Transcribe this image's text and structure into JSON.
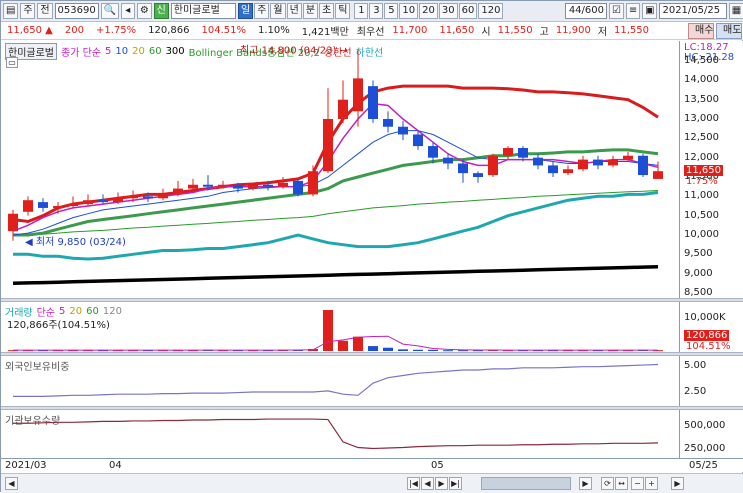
{
  "toolbar": {
    "mode_label": "주",
    "type_label": "전",
    "stock_code": "053690",
    "stock_name": "한미글로벌",
    "period_tabs": [
      "일",
      "주",
      "월",
      "년",
      "분",
      "초",
      "틱"
    ],
    "interval_buttons": [
      "1",
      "3",
      "5",
      "10",
      "20",
      "30",
      "60",
      "120"
    ],
    "count_display": "44/600",
    "date_display": "2021/05/25",
    "sin_label": "신"
  },
  "info": {
    "price": "11,650",
    "change": "200",
    "change_pct": "+1.75%",
    "volume": "120,866",
    "volume_ratio": "104.51%",
    "turnover": "1.10%",
    "amount": "1,421백만",
    "label_best": "최우선",
    "best_price": "11,700",
    "best_price2": "11,650",
    "open_label": "시",
    "open": "11,550",
    "high_label": "고",
    "high": "11,900",
    "low_label": "저",
    "low": "11,550",
    "buy_label": "매수",
    "sell_label": "매도"
  },
  "price_panel": {
    "legend_name": "한미글로벌",
    "legend_ma_label": "종가 단순",
    "legend_ma": [
      "5",
      "10",
      "20",
      "60",
      "300"
    ],
    "legend_bb": "Bollinger Bands중심선 20,2",
    "legend_upper": "상한선",
    "legend_lower": "하한선",
    "high_annotation": "최고 14,800 (04/23)",
    "low_annotation": "최저 9,850 (03/24)",
    "lc_label": "LC:18.27",
    "hc_label": "HC:-21.28",
    "current_price_badge": "11,650",
    "current_pct_badge": "1.75%",
    "ticks": [
      "14,500",
      "14,000",
      "13,500",
      "13,000",
      "12,500",
      "12,000",
      "11,500",
      "11,000",
      "10,500",
      "10,000",
      "9,500",
      "9,000",
      "8,500"
    ]
  },
  "volume_panel": {
    "legend_label": "거래량",
    "legend_ma_label": "단순",
    "legend_ma": [
      "5",
      "20",
      "60",
      "120"
    ],
    "sub_label": "120,866주(104.51%)",
    "tick_top": "10,000K",
    "badge_value": "120,866",
    "badge_pct": "104.51%"
  },
  "foreign_panel": {
    "legend_label": "외국인보유비중",
    "ticks": [
      "5.00",
      "2.50"
    ]
  },
  "inst_panel": {
    "legend_label": "기관보유수량",
    "ticks": [
      "500,000",
      "250,000"
    ]
  },
  "xaxis": {
    "labels": [
      "2021/03",
      "04",
      "05",
      "05/25"
    ]
  },
  "chart_data": {
    "type": "line",
    "ylim": [
      8500,
      14500
    ],
    "candles": [
      {
        "o": 10100,
        "c": 10550,
        "h": 10650,
        "l": 9850
      },
      {
        "o": 10600,
        "c": 10900,
        "h": 11000,
        "l": 10500
      },
      {
        "o": 10850,
        "c": 10700,
        "h": 10950,
        "l": 10600
      },
      {
        "o": 10700,
        "c": 10750,
        "h": 10850,
        "l": 10550
      },
      {
        "o": 10750,
        "c": 10800,
        "h": 11000,
        "l": 10700
      },
      {
        "o": 10800,
        "c": 10900,
        "h": 11050,
        "l": 10750
      },
      {
        "o": 10900,
        "c": 10850,
        "h": 11050,
        "l": 10800
      },
      {
        "o": 10850,
        "c": 10950,
        "h": 11100,
        "l": 10800
      },
      {
        "o": 10950,
        "c": 11000,
        "h": 11150,
        "l": 10850
      },
      {
        "o": 11000,
        "c": 10950,
        "h": 11100,
        "l": 10850
      },
      {
        "o": 10950,
        "c": 11050,
        "h": 11200,
        "l": 10900
      },
      {
        "o": 11050,
        "c": 11200,
        "h": 11400,
        "l": 11000
      },
      {
        "o": 11200,
        "c": 11300,
        "h": 11450,
        "l": 11100
      },
      {
        "o": 11300,
        "c": 11250,
        "h": 11550,
        "l": 11150
      },
      {
        "o": 11250,
        "c": 11300,
        "h": 11400,
        "l": 11200
      },
      {
        "o": 11300,
        "c": 11200,
        "h": 11350,
        "l": 11100
      },
      {
        "o": 11200,
        "c": 11300,
        "h": 11350,
        "l": 11150
      },
      {
        "o": 11300,
        "c": 11250,
        "h": 11400,
        "l": 11150
      },
      {
        "o": 11250,
        "c": 11350,
        "h": 11500,
        "l": 11200
      },
      {
        "o": 11400,
        "c": 11050,
        "h": 11450,
        "l": 11000
      },
      {
        "o": 11050,
        "c": 11650,
        "h": 11800,
        "l": 11000
      },
      {
        "o": 11650,
        "c": 13000,
        "h": 13800,
        "l": 11600
      },
      {
        "o": 13000,
        "c": 13500,
        "h": 14000,
        "l": 12900
      },
      {
        "o": 13200,
        "c": 14050,
        "h": 14800,
        "l": 12800
      },
      {
        "o": 13850,
        "c": 13000,
        "h": 14000,
        "l": 12900
      },
      {
        "o": 13000,
        "c": 12800,
        "h": 13200,
        "l": 12650
      },
      {
        "o": 12800,
        "c": 12600,
        "h": 12950,
        "l": 12450
      },
      {
        "o": 12600,
        "c": 12300,
        "h": 12700,
        "l": 12200
      },
      {
        "o": 12300,
        "c": 12000,
        "h": 12400,
        "l": 11850
      },
      {
        "o": 12000,
        "c": 11850,
        "h": 12100,
        "l": 11700
      },
      {
        "o": 11850,
        "c": 11600,
        "h": 11950,
        "l": 11350
      },
      {
        "o": 11600,
        "c": 11500,
        "h": 11650,
        "l": 11350
      },
      {
        "o": 11550,
        "c": 12050,
        "h": 12100,
        "l": 11500
      },
      {
        "o": 12050,
        "c": 12250,
        "h": 12300,
        "l": 11950
      },
      {
        "o": 12250,
        "c": 12000,
        "h": 12300,
        "l": 11900
      },
      {
        "o": 12000,
        "c": 11800,
        "h": 12100,
        "l": 11700
      },
      {
        "o": 11800,
        "c": 11600,
        "h": 11900,
        "l": 11500
      },
      {
        "o": 11600,
        "c": 11700,
        "h": 11800,
        "l": 11550
      },
      {
        "o": 11700,
        "c": 11950,
        "h": 12050,
        "l": 11650
      },
      {
        "o": 11950,
        "c": 11800,
        "h": 12050,
        "l": 11700
      },
      {
        "o": 11800,
        "c": 11950,
        "h": 12050,
        "l": 11750
      },
      {
        "o": 11950,
        "c": 12050,
        "h": 12150,
        "l": 11900
      },
      {
        "o": 12050,
        "c": 11550,
        "h": 12100,
        "l": 11500
      },
      {
        "o": 11450,
        "c": 11650,
        "h": 11900,
        "l": 11550
      }
    ],
    "bb_upper": [
      10400,
      10350,
      10500,
      10700,
      10800,
      10850,
      10900,
      10950,
      11000,
      11050,
      11050,
      11100,
      11150,
      11200,
      11250,
      11300,
      11320,
      11350,
      11400,
      11450,
      11600,
      12400,
      13000,
      13400,
      13700,
      13800,
      13850,
      13850,
      13850,
      13850,
      13800,
      13800,
      13800,
      13780,
      13750,
      13700,
      13700,
      13680,
      13650,
      13600,
      13550,
      13500,
      13300,
      13050
    ],
    "bb_mid": [
      10000,
      10000,
      10050,
      10150,
      10250,
      10350,
      10400,
      10450,
      10500,
      10550,
      10600,
      10650,
      10700,
      10750,
      10800,
      10850,
      10900,
      10950,
      11000,
      11050,
      11100,
      11200,
      11400,
      11500,
      11600,
      11700,
      11800,
      11850,
      11900,
      11950,
      11950,
      12000,
      12050,
      12050,
      12100,
      12100,
      12120,
      12150,
      12150,
      12180,
      12200,
      12200,
      12150,
      12100
    ],
    "bb_lower": [
      9500,
      9500,
      9450,
      9450,
      9400,
      9380,
      9400,
      9450,
      9500,
      9550,
      9600,
      9600,
      9620,
      9650,
      9650,
      9700,
      9750,
      9800,
      9900,
      10000,
      9900,
      9800,
      9750,
      9700,
      9700,
      9700,
      9750,
      9800,
      9900,
      10000,
      10100,
      10200,
      10350,
      10500,
      10600,
      10700,
      10800,
      10900,
      10950,
      11000,
      11000,
      11050,
      11050,
      11100
    ],
    "ma5": [
      10100,
      10250,
      10450,
      10600,
      10700,
      10750,
      10800,
      10850,
      10900,
      10950,
      11000,
      11050,
      11100,
      11200,
      11250,
      11250,
      11250,
      11250,
      11250,
      11250,
      11400,
      11900,
      12500,
      13000,
      13400,
      13350,
      13000,
      12700,
      12400,
      12100,
      11900,
      11800,
      11800,
      11950,
      11950,
      11950,
      11950,
      11900,
      11850,
      11900,
      11950,
      11950,
      11850,
      11750
    ],
    "ma10": [
      10000,
      10050,
      10150,
      10300,
      10450,
      10550,
      10650,
      10700,
      10750,
      10800,
      10850,
      10900,
      10950,
      11000,
      11100,
      11150,
      11200,
      11220,
      11250,
      11250,
      11300,
      11500,
      11800,
      12100,
      12400,
      12600,
      12700,
      12700,
      12600,
      12400,
      12200,
      12000,
      11950,
      11950,
      11950,
      11950,
      11900,
      11850,
      11850,
      11900,
      11900,
      11900,
      11850,
      11800
    ],
    "ma60": [
      10000,
      10000,
      10020,
      10050,
      10080,
      10100,
      10120,
      10150,
      10180,
      10200,
      10230,
      10250,
      10280,
      10300,
      10330,
      10350,
      10380,
      10400,
      10430,
      10450,
      10480,
      10550,
      10600,
      10650,
      10700,
      10730,
      10760,
      10800,
      10820,
      10850,
      10870,
      10900,
      10920,
      10950,
      10970,
      11000,
      11020,
      11040,
      11060,
      11080,
      11100,
      11120,
      11130,
      11150
    ],
    "ma300": [
      8750,
      8760,
      8770,
      8780,
      8790,
      8800,
      8810,
      8820,
      8830,
      8840,
      8850,
      8860,
      8870,
      8880,
      8890,
      8900,
      8910,
      8920,
      8930,
      8940,
      8950,
      8960,
      8970,
      8980,
      8990,
      9000,
      9010,
      9020,
      9030,
      9040,
      9050,
      9060,
      9070,
      9080,
      9090,
      9100,
      9110,
      9120,
      9130,
      9140,
      9150,
      9160,
      9170,
      9180
    ],
    "volume": [
      0.02,
      0.02,
      0.02,
      0.02,
      0.02,
      0.02,
      0.02,
      0.02,
      0.02,
      0.02,
      0.02,
      0.02,
      0.02,
      0.03,
      0.02,
      0.02,
      0.02,
      0.02,
      0.03,
      0.03,
      0.05,
      1.0,
      0.25,
      0.35,
      0.12,
      0.08,
      0.04,
      0.03,
      0.03,
      0.02,
      0.02,
      0.02,
      0.03,
      0.02,
      0.02,
      0.02,
      0.02,
      0.02,
      0.02,
      0.02,
      0.02,
      0.02,
      0.03,
      0.02
    ],
    "foreign": [
      2.1,
      2.1,
      2.1,
      2.15,
      2.2,
      2.2,
      2.25,
      2.3,
      2.3,
      2.3,
      2.35,
      2.35,
      2.4,
      2.4,
      2.4,
      2.45,
      2.5,
      2.5,
      2.5,
      2.5,
      2.5,
      2.6,
      2.3,
      2.2,
      3.3,
      3.8,
      4.0,
      4.2,
      4.3,
      4.4,
      4.5,
      4.5,
      4.6,
      4.6,
      4.7,
      4.7,
      4.7,
      4.75,
      4.8,
      4.8,
      4.85,
      4.9,
      4.95,
      5.0
    ],
    "institution": [
      540000,
      540000,
      545000,
      550000,
      550000,
      555000,
      560000,
      560000,
      565000,
      565000,
      570000,
      570000,
      575000,
      575000,
      580000,
      580000,
      580000,
      585000,
      585000,
      585000,
      585000,
      580000,
      340000,
      280000,
      270000,
      275000,
      280000,
      290000,
      295000,
      300000,
      300000,
      305000,
      305000,
      305000,
      310000,
      310000,
      315000,
      315000,
      320000,
      320000,
      325000,
      325000,
      325000,
      330000
    ]
  }
}
